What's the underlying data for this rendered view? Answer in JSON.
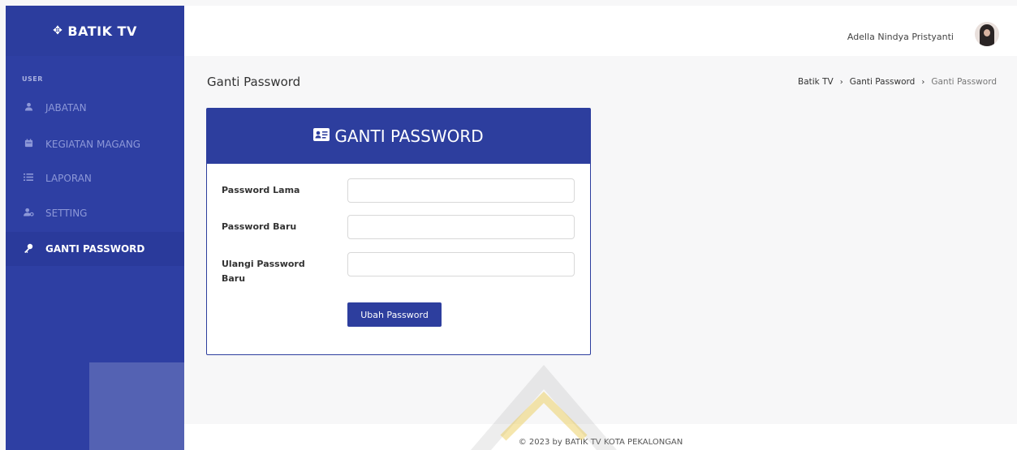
{
  "brand": {
    "name": "BATIK TV",
    "icon": "batik-logo-icon"
  },
  "sidebar": {
    "section_label": "USER",
    "items": [
      {
        "label": "JABATAN",
        "icon": "user-icon",
        "active": false
      },
      {
        "label": "KEGIATAN MAGANG",
        "icon": "calendar-icon",
        "active": false
      },
      {
        "label": "LAPORAN",
        "icon": "list-icon",
        "active": false
      },
      {
        "label": "SETTING",
        "icon": "user-cog-icon",
        "active": false
      },
      {
        "label": "GANTI PASSWORD",
        "icon": "key-icon",
        "active": true
      }
    ]
  },
  "header": {
    "user_name": "Adella Nindya Pristyanti",
    "avatar_icon": "avatar"
  },
  "page": {
    "title": "Ganti Password",
    "breadcrumb": [
      "Batik TV",
      "Ganti Password",
      "Ganti Password"
    ]
  },
  "form": {
    "title": "GANTI PASSWORD",
    "title_icon": "id-card-icon",
    "fields": [
      {
        "label": "Password Lama",
        "value": ""
      },
      {
        "label": "Password Baru",
        "value": ""
      },
      {
        "label": "Ulangi Password Baru",
        "value": ""
      }
    ],
    "submit_label": "Ubah Password"
  },
  "footer": {
    "text": "© 2023 by BATIK TV KOTA PEKALONGAN"
  },
  "colors": {
    "primary": "#2d3e9e",
    "sidebar_bg": "#2e3fa3",
    "sidebar_text": "#8d98d8",
    "page_bg": "#f7f7f8",
    "watermark": "#e8c84a"
  }
}
